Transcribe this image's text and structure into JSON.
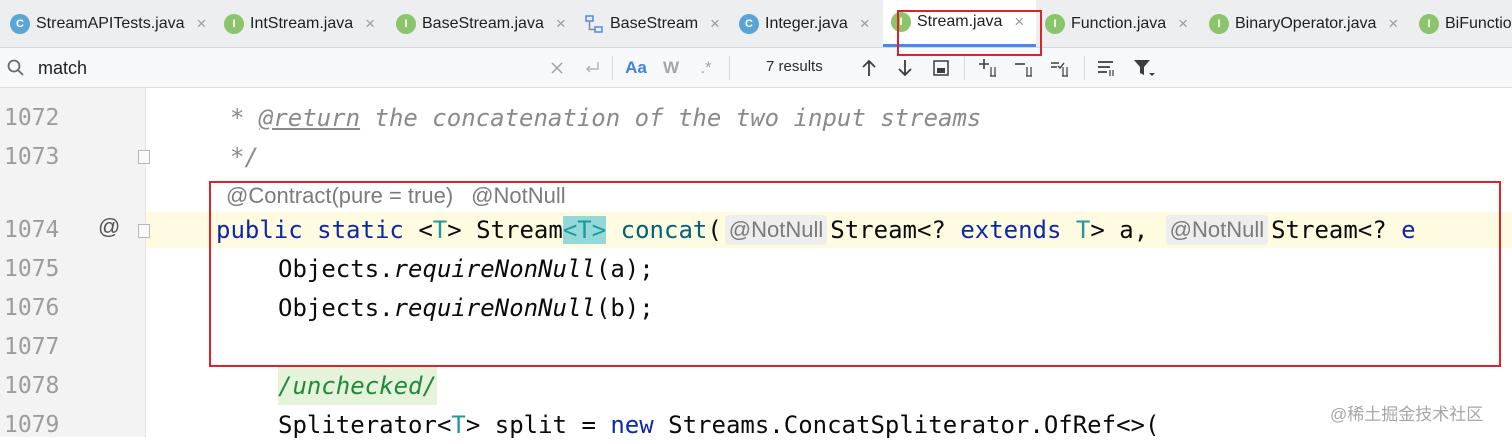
{
  "tabs": [
    {
      "label": "StreamAPITests.java",
      "icon": "class-icon",
      "letter": "C",
      "active": false
    },
    {
      "label": "IntStream.java",
      "icon": "interface-icon",
      "letter": "I",
      "active": false
    },
    {
      "label": "BaseStream.java",
      "icon": "interface-icon",
      "letter": "I",
      "active": false
    },
    {
      "label": "BaseStream",
      "icon": "diagram-icon",
      "letter": "",
      "active": false
    },
    {
      "label": "Integer.java",
      "icon": "class-icon",
      "letter": "C",
      "active": false
    },
    {
      "label": "Stream.java",
      "icon": "interface-icon",
      "letter": "I",
      "active": true
    },
    {
      "label": "Function.java",
      "icon": "interface-icon",
      "letter": "I",
      "active": false
    },
    {
      "label": "BinaryOperator.java",
      "icon": "interface-icon",
      "letter": "I",
      "active": false
    },
    {
      "label": "BiFunctio",
      "icon": "interface-icon",
      "letter": "I",
      "active": false
    }
  ],
  "tab_close_glyph": "×",
  "search": {
    "value": "match",
    "match_case_label": "Aa",
    "words_label": "W",
    "regex_label": ".*",
    "results": "7 results"
  },
  "gutter": {
    "line_numbers": [
      "1072",
      "1073",
      "1074",
      "1075",
      "1076",
      "1077",
      "1078",
      "1079"
    ],
    "implements_marker": "@"
  },
  "code": {
    "l1072": {
      "star": "* ",
      "tag": "@return",
      "text": " the concatenation of the two input streams"
    },
    "l1073": "*/",
    "annotations": [
      "@Contract(pure = true)",
      "@NotNull"
    ],
    "l1074": {
      "kw1": "public",
      "kw2": "static",
      "open": "<",
      "t1": "T",
      "close": ">",
      "type": "Stream",
      "t2": "T",
      "name": "concat",
      "paren": "(",
      "inlay1": "@NotNull",
      "param1": "Stream<? ",
      "ext1": "extends",
      "sp1": " ",
      "t3": "T",
      "rest1": "> a, ",
      "inlay2": "@NotNull",
      "param2": "Stream<? ",
      "ext2": "e"
    },
    "l1075": {
      "obj": "Objects.",
      "method": "requireNonNull",
      "args": "(a);"
    },
    "l1076": {
      "obj": "Objects.",
      "method": "requireNonNull",
      "args": "(b);"
    },
    "l1078": "/unchecked/",
    "l1079": {
      "type": "Spliterator<",
      "t": "T",
      "mid": "> split = ",
      "kw": "new",
      "rest": " Streams.ConcatSpliterator.OfRef<>("
    }
  },
  "watermark": "@稀土掘金技术社区",
  "colors": {
    "accent": "#4a88f0",
    "highlight_box": "#d9242a",
    "keyword": "#0d27a8",
    "type_param": "#20999d"
  }
}
